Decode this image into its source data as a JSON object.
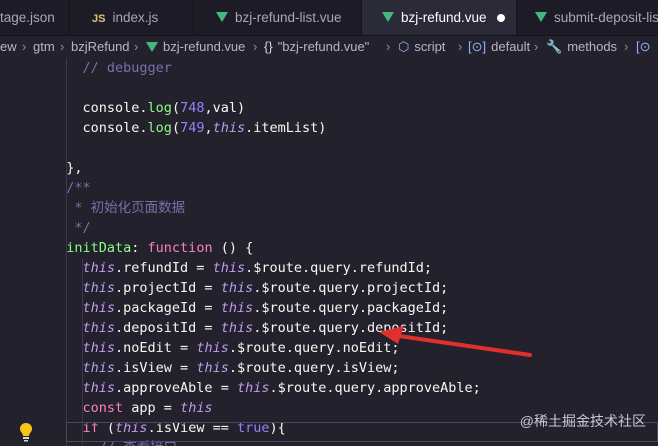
{
  "tabs": [
    {
      "label": "tage.json",
      "icon": "json-icon",
      "active": false
    },
    {
      "label": "index.js",
      "icon": "js-icon",
      "icon_text": "JS",
      "active": false
    },
    {
      "label": "bzj-refund-list.vue",
      "icon": "vue-icon",
      "active": false
    },
    {
      "label": "bzj-refund.vue",
      "icon": "vue-icon",
      "active": true,
      "dirty": true
    },
    {
      "label": "submit-deposit-list.vu",
      "icon": "vue-icon",
      "active": false
    }
  ],
  "breadcrumb": {
    "items": [
      "ew",
      "gtm",
      "bzjRefund",
      "bzj-refund.vue",
      "\"bzj-refund.vue\"",
      "script",
      "default",
      "methods"
    ],
    "separator": "›"
  },
  "code": {
    "lines": [
      [
        {
          "t": "    // debugger",
          "c": "comment"
        }
      ],
      [],
      [
        {
          "t": "    console",
          "c": "prop"
        },
        {
          "t": ".",
          "c": "prop"
        },
        {
          "t": "log",
          "c": "fn"
        },
        {
          "t": "(",
          "c": "prop"
        },
        {
          "t": "748",
          "c": "num"
        },
        {
          "t": ",val)",
          "c": "prop"
        }
      ],
      [
        {
          "t": "    console",
          "c": "prop"
        },
        {
          "t": ".",
          "c": "prop"
        },
        {
          "t": "log",
          "c": "fn"
        },
        {
          "t": "(",
          "c": "prop"
        },
        {
          "t": "749",
          "c": "num"
        },
        {
          "t": ",",
          "c": "prop"
        },
        {
          "t": "this",
          "c": "this"
        },
        {
          "t": ".itemList)",
          "c": "prop"
        }
      ],
      [],
      [
        {
          "t": "  },",
          "c": "prop"
        }
      ],
      [
        {
          "t": "  /**",
          "c": "comment"
        }
      ],
      [
        {
          "t": "   * 初始化页面数据",
          "c": "comment"
        }
      ],
      [
        {
          "t": "   */",
          "c": "comment"
        }
      ],
      [
        {
          "t": "  initData",
          "c": "def"
        },
        {
          "t": ": ",
          "c": "prop"
        },
        {
          "t": "function",
          "c": "kw"
        },
        {
          "t": " () {",
          "c": "prop"
        }
      ],
      [
        {
          "t": "    this",
          "c": "this"
        },
        {
          "t": ".refundId = ",
          "c": "prop"
        },
        {
          "t": "this",
          "c": "this"
        },
        {
          "t": ".$route.query.refundId;",
          "c": "prop"
        }
      ],
      [
        {
          "t": "    this",
          "c": "this"
        },
        {
          "t": ".projectId = ",
          "c": "prop"
        },
        {
          "t": "this",
          "c": "this"
        },
        {
          "t": ".$route.query.projectId;",
          "c": "prop"
        }
      ],
      [
        {
          "t": "    this",
          "c": "this"
        },
        {
          "t": ".packageId = ",
          "c": "prop"
        },
        {
          "t": "this",
          "c": "this"
        },
        {
          "t": ".$route.query.packageId;",
          "c": "prop"
        }
      ],
      [
        {
          "t": "    this",
          "c": "this"
        },
        {
          "t": ".depositId = ",
          "c": "prop"
        },
        {
          "t": "this",
          "c": "this"
        },
        {
          "t": ".$route.query.depositId;",
          "c": "prop"
        }
      ],
      [
        {
          "t": "    this",
          "c": "this"
        },
        {
          "t": ".noEdit = ",
          "c": "prop"
        },
        {
          "t": "this",
          "c": "this"
        },
        {
          "t": ".$route.query.noEdit;",
          "c": "prop"
        }
      ],
      [
        {
          "t": "    this",
          "c": "this"
        },
        {
          "t": ".isView = ",
          "c": "prop"
        },
        {
          "t": "this",
          "c": "this"
        },
        {
          "t": ".$route.query.isView;",
          "c": "prop"
        }
      ],
      [
        {
          "t": "    this",
          "c": "this"
        },
        {
          "t": ".approveAble = ",
          "c": "prop"
        },
        {
          "t": "this",
          "c": "this"
        },
        {
          "t": ".$route.query.approveAble;",
          "c": "prop"
        }
      ],
      [
        {
          "t": "    const",
          "c": "kw"
        },
        {
          "t": " app = ",
          "c": "prop"
        },
        {
          "t": "this",
          "c": "this"
        }
      ],
      [
        {
          "t": "    if",
          "c": "kw"
        },
        {
          "t": " (",
          "c": "prop"
        },
        {
          "t": "this",
          "c": "this"
        },
        {
          "t": ".isView == ",
          "c": "prop"
        },
        {
          "t": "true",
          "c": "purple"
        },
        {
          "t": "){",
          "c": "prop"
        }
      ],
      [
        {
          "t": "      // 查看接口",
          "c": "comment"
        }
      ]
    ]
  },
  "watermark": "@稀土掘金技术社区",
  "colors": {
    "background": "#22212c",
    "annotation_arrow": "#e0302e",
    "vue_icon": "#41b883"
  }
}
